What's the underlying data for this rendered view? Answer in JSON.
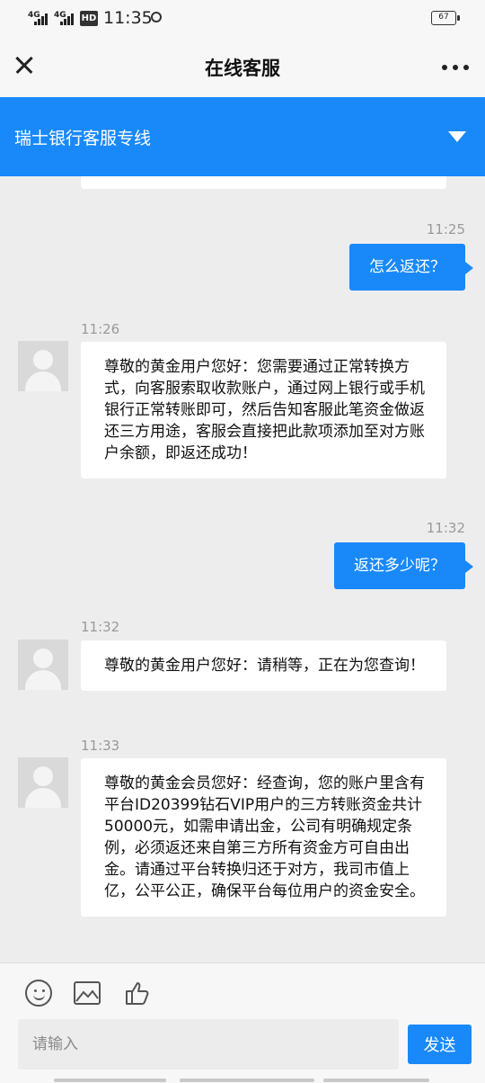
{
  "statusbar": {
    "network1": "4G",
    "network2": "4G",
    "hd": "HD",
    "time": "11:35",
    "battery": "67"
  },
  "navbar": {
    "title": "在线客服"
  },
  "banner": {
    "title": "瑞士银行客服专线"
  },
  "messages": [
    {
      "time": "11:25",
      "text": "怎么返还？"
    },
    {
      "time": "11:26",
      "text": "尊敬的黄金用户您好：您需要通过正常转换方式，向客服索取收款账户，通过网上银行或手机银行正常转账即可，然后告知客服此笔资金做返还三方用途，客服会直接把此款项添加至对方账户余额，即返还成功！"
    },
    {
      "time": "11:32",
      "text": "返还多少呢？"
    },
    {
      "time": "11:32",
      "text": "尊敬的黄金用户您好：请稍等，正在为您查询！"
    },
    {
      "time": "11:33",
      "text": "尊敬的黄金会员您好：经查询，您的账户里含有平台ID20399钻石VIP用户的三方转账资金共计50000元，如需申请出金，公司有明确规定条例，必须返还来自第三方所有资金方可自由出金。请通过平台转换归还于对方，我司市值上亿，公平公正，确保平台每位用户的资金安全。"
    }
  ],
  "input": {
    "placeholder": "请输入"
  },
  "send": {
    "label": "发送"
  },
  "colors": {
    "accent": "#1989fa",
    "background": "#ededed"
  }
}
